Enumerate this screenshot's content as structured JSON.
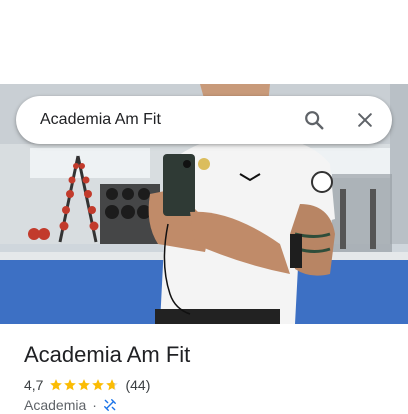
{
  "search": {
    "query": "Academia Am Fit"
  },
  "place": {
    "name": "Academia Am Fit",
    "rating": "4,7",
    "rating_value": 4.7,
    "review_count": "(44)",
    "category": "Academia",
    "separator": "·",
    "category_icon": "gym-dumbbell-icon"
  },
  "icons": {
    "search": "search-icon",
    "close": "close-icon"
  },
  "colors": {
    "star": "#fbbc04",
    "star_empty": "#dadce0",
    "icon_gray": "#5f6368",
    "accent_blue": "#1a73e8"
  }
}
